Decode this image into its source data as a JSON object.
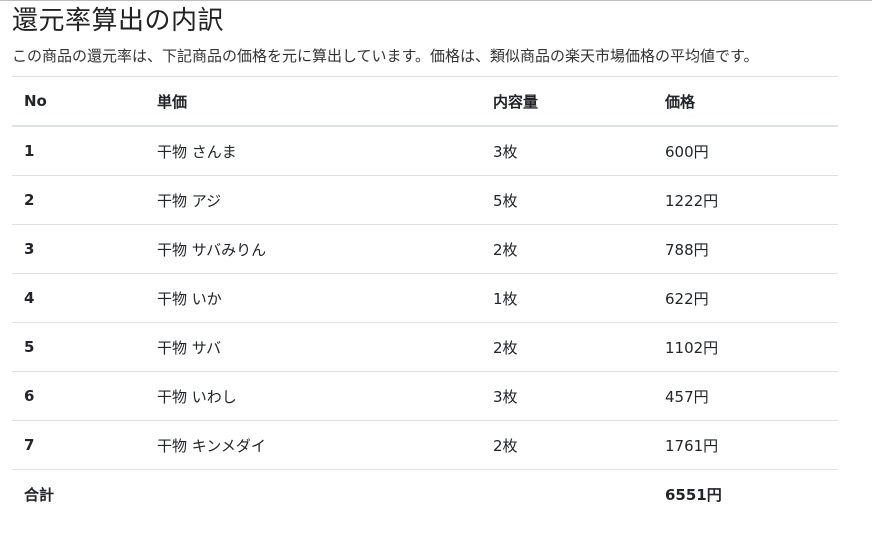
{
  "page": {
    "title": "還元率算出の内訳",
    "description": "この商品の還元率は、下記商品の価格を元に算出しています。価格は、類似商品の楽天市場価格の平均値です。"
  },
  "table": {
    "headers": {
      "no": "No",
      "unit": "単価",
      "content": "内容量",
      "price": "価格"
    },
    "rows": [
      {
        "no": "1",
        "unit": "干物 さんま",
        "content": "3枚",
        "price": "600円"
      },
      {
        "no": "2",
        "unit": "干物 アジ",
        "content": "5枚",
        "price": "1222円"
      },
      {
        "no": "3",
        "unit": "干物 サバみりん",
        "content": "2枚",
        "price": "788円"
      },
      {
        "no": "4",
        "unit": "干物 いか",
        "content": "1枚",
        "price": "622円"
      },
      {
        "no": "5",
        "unit": "干物 サバ",
        "content": "2枚",
        "price": "1102円"
      },
      {
        "no": "6",
        "unit": "干物 いわし",
        "content": "3枚",
        "price": "457円"
      },
      {
        "no": "7",
        "unit": "干物 キンメダイ",
        "content": "2枚",
        "price": "1761円"
      }
    ],
    "total": {
      "label": "合計",
      "price": "6551円"
    }
  }
}
